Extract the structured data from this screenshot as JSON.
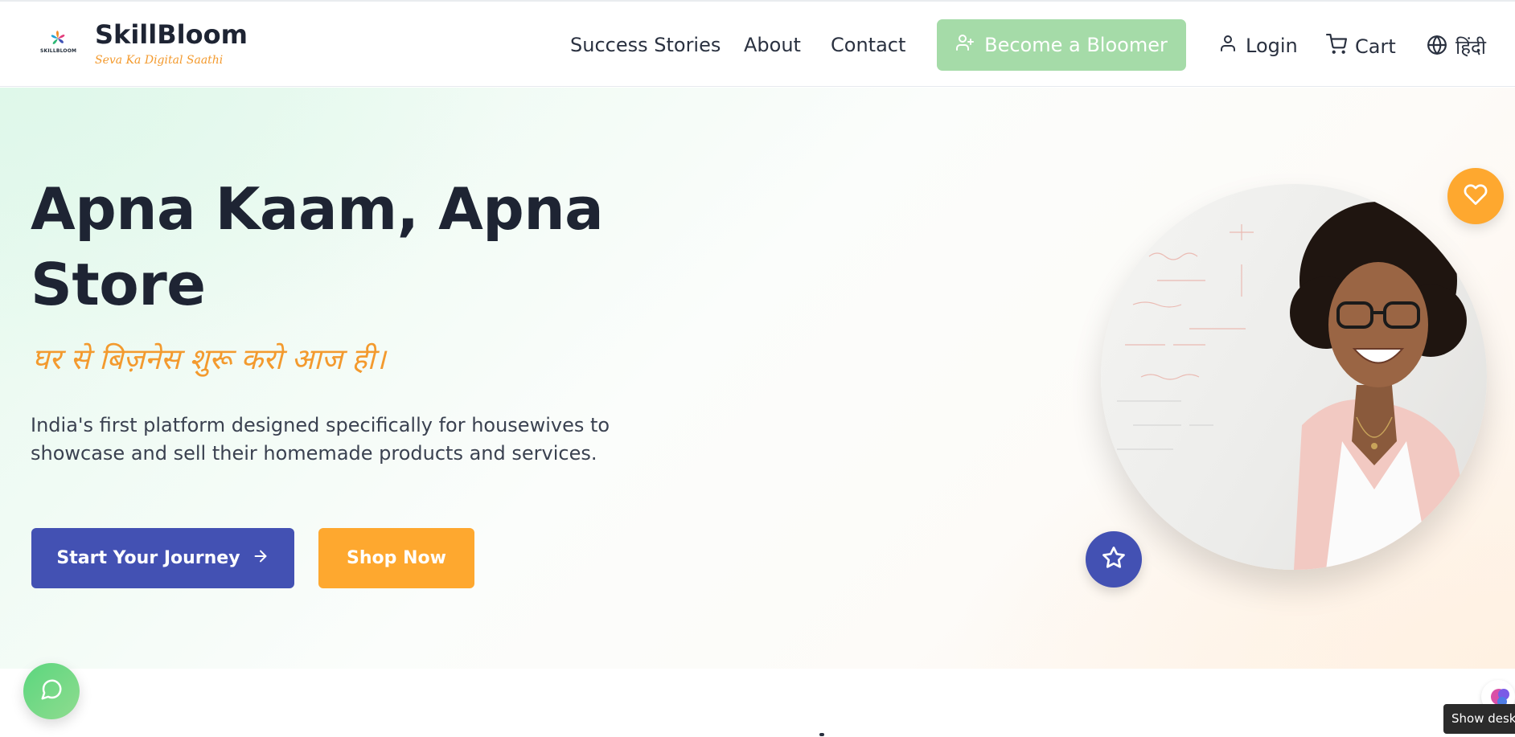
{
  "header": {
    "logo_text": "SKILLBLOOM",
    "brand_name": "SkillBloom",
    "tagline": "Seva Ka Digital Saathi",
    "nav": [
      {
        "label": "Success Stories"
      },
      {
        "label": "About"
      },
      {
        "label": "Contact"
      }
    ],
    "become_button": "Become a Bloomer",
    "login_label": "Login",
    "cart_label": "Cart",
    "language_label": "हिंदी"
  },
  "hero": {
    "title": "Apna Kaam, Apna Store",
    "subtitle": "घर से बिज़नेस शुरू करो आज ही।",
    "description": "India's first platform designed specifically for housewives to showcase and sell their homemade products and services.",
    "primary_button": "Start Your Journey",
    "secondary_button": "Shop Now"
  },
  "floating": {
    "tooltip": "Show desktop"
  },
  "colors": {
    "primary": "#4351b3",
    "accent": "#fea82f",
    "green": "#a5dba8",
    "text": "#1e2433"
  },
  "icons": [
    "user-plus-icon",
    "user-icon",
    "cart-icon",
    "globe-icon",
    "arrow-right-icon",
    "heart-icon",
    "star-icon",
    "chat-icon"
  ]
}
